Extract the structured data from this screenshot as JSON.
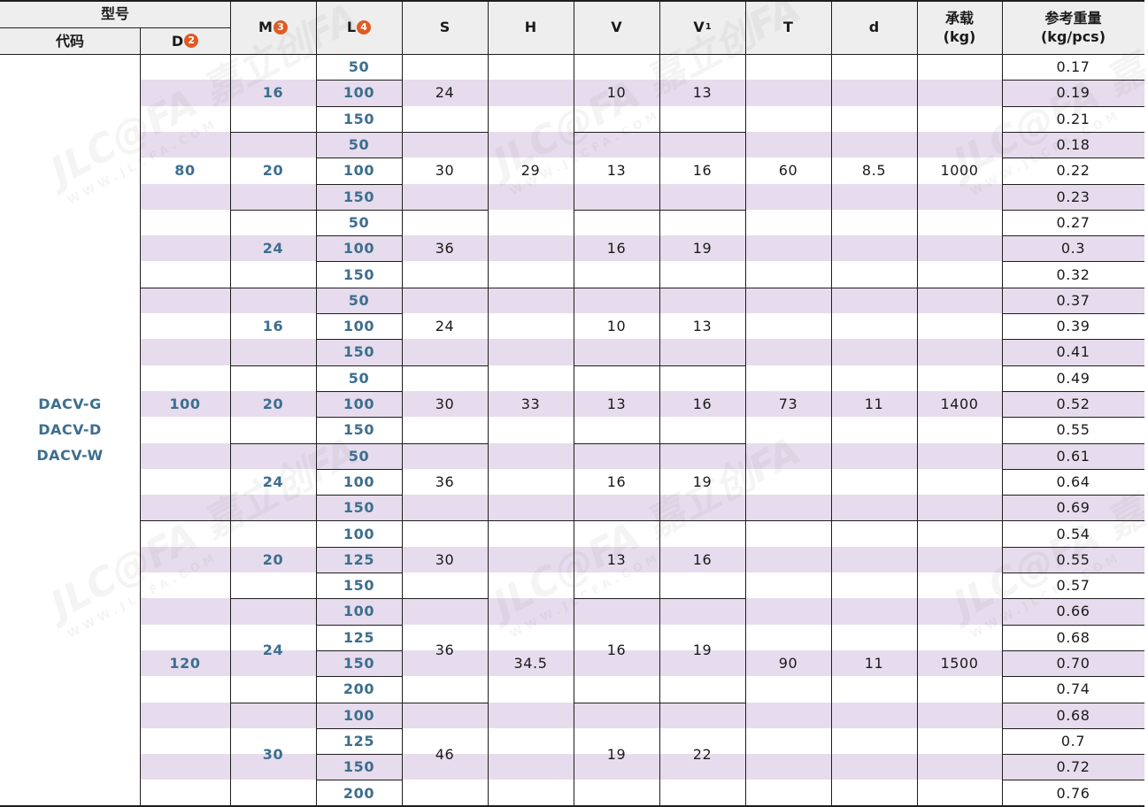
{
  "header": {
    "model_group": "型号",
    "code": "代码",
    "d_cap": "D",
    "d_badge": "2",
    "m": "M",
    "m_badge": "3",
    "l": "L",
    "l_badge": "4",
    "s": "S",
    "h": "H",
    "v": "V",
    "v1_main": "V",
    "v1_sub": "1",
    "t": "T",
    "d_small": "d",
    "load_line1": "承载",
    "load_line2": "(kg)",
    "weight_line1": "参考重量",
    "weight_line2": "(kg/pcs)"
  },
  "codes": [
    "DACV-G",
    "DACV-D",
    "DACV-W"
  ],
  "groups": [
    {
      "D": "80",
      "H": "29",
      "T": "60",
      "d": "8.5",
      "load": "1000",
      "subgroups": [
        {
          "M": "16",
          "S": "24",
          "V": "10",
          "V1": "13",
          "L": [
            "50",
            "100",
            "150"
          ],
          "W": [
            "0.17",
            "0.19",
            "0.21"
          ]
        },
        {
          "M": "20",
          "S": "30",
          "V": "13",
          "V1": "16",
          "L": [
            "50",
            "100",
            "150"
          ],
          "W": [
            "0.18",
            "0.22",
            "0.23"
          ]
        },
        {
          "M": "24",
          "S": "36",
          "V": "16",
          "V1": "19",
          "L": [
            "50",
            "100",
            "150"
          ],
          "W": [
            "0.27",
            "0.3",
            "0.32"
          ]
        }
      ]
    },
    {
      "D": "100",
      "H": "33",
      "T": "73",
      "d": "11",
      "load": "1400",
      "subgroups": [
        {
          "M": "16",
          "S": "24",
          "V": "10",
          "V1": "13",
          "L": [
            "50",
            "100",
            "150"
          ],
          "W": [
            "0.37",
            "0.39",
            "0.41"
          ]
        },
        {
          "M": "20",
          "S": "30",
          "V": "13",
          "V1": "16",
          "L": [
            "50",
            "100",
            "150"
          ],
          "W": [
            "0.49",
            "0.52",
            "0.55"
          ]
        },
        {
          "M": "24",
          "S": "36",
          "V": "16",
          "V1": "19",
          "L": [
            "50",
            "100",
            "150"
          ],
          "W": [
            "0.61",
            "0.64",
            "0.69"
          ]
        }
      ]
    },
    {
      "D": "120",
      "H": "34.5",
      "T": "90",
      "d": "11",
      "load": "1500",
      "subgroups": [
        {
          "M": "20",
          "S": "30",
          "V": "13",
          "V1": "16",
          "L": [
            "100",
            "125",
            "150"
          ],
          "W": [
            "0.54",
            "0.55",
            "0.57"
          ]
        },
        {
          "M": "24",
          "S": "36",
          "V": "16",
          "V1": "19",
          "L": [
            "100",
            "125",
            "150",
            "200"
          ],
          "W": [
            "0.66",
            "0.68",
            "0.70",
            "0.74"
          ]
        },
        {
          "M": "30",
          "S": "46",
          "V": "19",
          "V1": "22",
          "L": [
            "100",
            "125",
            "150",
            "200"
          ],
          "W": [
            "0.68",
            "0.7",
            "0.72",
            "0.76"
          ]
        }
      ]
    }
  ],
  "watermark": {
    "logo": "JLC@FA",
    "brand": "嘉立创FA",
    "url": "WWW.JLCFA.COM"
  }
}
